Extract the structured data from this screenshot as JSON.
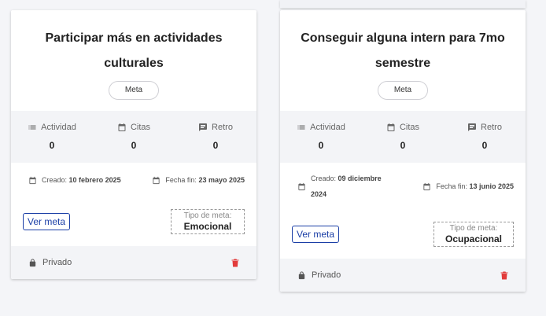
{
  "cards": [
    {
      "title": "Participar más en actividades culturales",
      "chip": "Meta",
      "stats": [
        {
          "label": "Actividad",
          "value": "0",
          "icon": "list-icon"
        },
        {
          "label": "Citas",
          "value": "0",
          "icon": "calendar-icon"
        },
        {
          "label": "Retro",
          "value": "0",
          "icon": "comment-icon"
        }
      ],
      "created_label": "Creado:",
      "created_date": "10 febrero 2025",
      "end_label": "Fecha fin:",
      "end_date": "23 mayo 2025",
      "button": "Ver meta",
      "type_label": "Tipo de meta:",
      "type_value": "Emocional",
      "privacy": "Privado"
    },
    {
      "title": "Conseguir alguna intern para 7mo semestre",
      "chip": "Meta",
      "stats": [
        {
          "label": "Actividad",
          "value": "0",
          "icon": "list-icon"
        },
        {
          "label": "Citas",
          "value": "0",
          "icon": "calendar-icon"
        },
        {
          "label": "Retro",
          "value": "0",
          "icon": "comment-icon"
        }
      ],
      "created_label": "Creado:",
      "created_date": "09 diciembre 2024",
      "end_label": "Fecha fin:",
      "end_date": "13 junio 2025",
      "button": "Ver meta",
      "type_label": "Tipo de meta:",
      "type_value": "Ocupacional",
      "privacy": "Privado"
    }
  ],
  "colors": {
    "accent": "#1a3ea6",
    "danger": "#e23b3b",
    "panel": "#f3f4f7"
  }
}
